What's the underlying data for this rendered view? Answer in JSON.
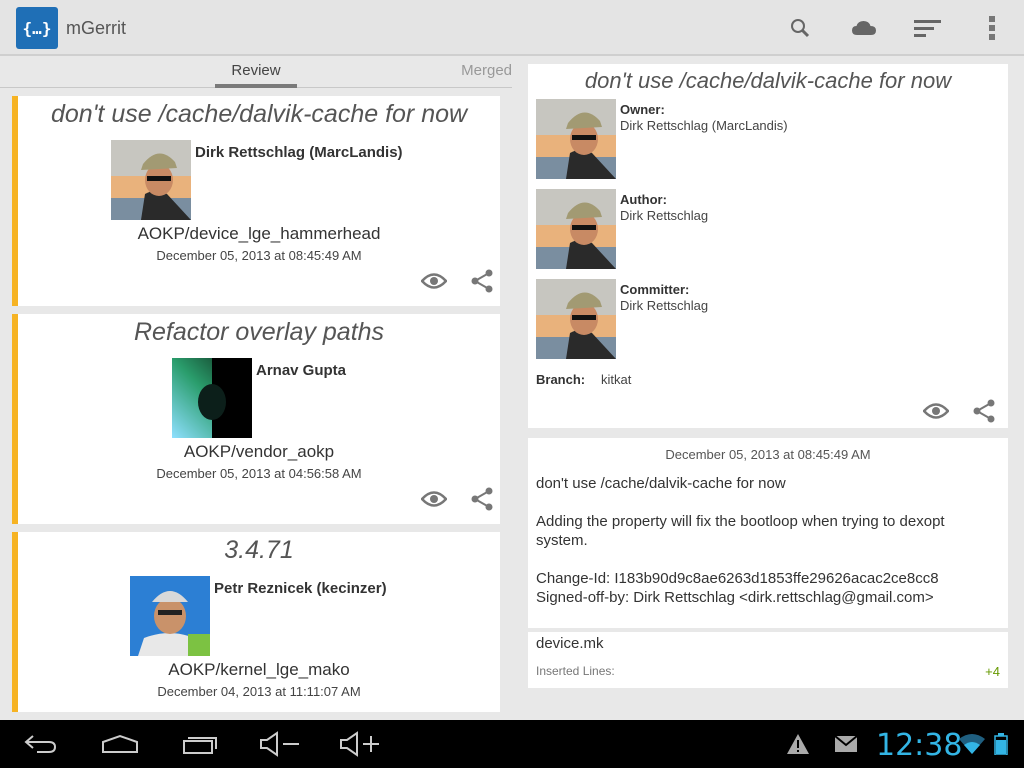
{
  "app": {
    "logo_text": "{…}",
    "title": "mGerrit"
  },
  "actionbar_icons": [
    "search-icon",
    "cloud-icon",
    "sort-icon",
    "overflow-menu-icon"
  ],
  "tabs": {
    "review": "Review",
    "merged": "Merged"
  },
  "changes": [
    {
      "subject": "don't use /cache/dalvik-cache for now",
      "owner": "Dirk Rettschlag (MarcLandis)",
      "project": "AOKP/device_lge_hammerhead",
      "date": "December 05, 2013 at 08:45:49 AM"
    },
    {
      "subject": "Refactor overlay paths",
      "owner": "Arnav Gupta",
      "project": "AOKP/vendor_aokp",
      "date": "December 05, 2013 at 04:56:58 AM"
    },
    {
      "subject": "3.4.71",
      "owner": "Petr Reznicek (kecinzer)",
      "project": "AOKP/kernel_lge_mako",
      "date": "December 04, 2013 at 11:11:07 AM"
    }
  ],
  "detail": {
    "title": "don't use /cache/dalvik-cache for now",
    "owner_label": "Owner:",
    "owner": "Dirk Rettschlag (MarcLandis)",
    "author_label": "Author:",
    "author": "Dirk Rettschlag",
    "committer_label": "Committer:",
    "committer": "Dirk Rettschlag",
    "branch_label": "Branch:",
    "branch": "kitkat"
  },
  "commit": {
    "date": "December 05, 2013 at 08:45:49 AM",
    "subject": "don't use /cache/dalvik-cache for now",
    "body_line1": "Adding the property will fix the bootloop when trying to dexopt",
    "body_line2": "system.",
    "change_id": "Change-Id: I183b90d9c8ae6263d1853ffe29626acac2ce8cc8",
    "signed_off": "Signed-off-by: Dirk Rettschlag <dirk.rettschlag@gmail.com>"
  },
  "file": {
    "name": "device.mk",
    "inserted_label": "Inserted Lines:",
    "inserted_value": "+4"
  },
  "status": {
    "time": "12:38"
  },
  "colors": {
    "accent": "#f6b323",
    "clock": "#33b5e5",
    "app_logo": "#1f6fb6",
    "inserted": "#669900"
  }
}
